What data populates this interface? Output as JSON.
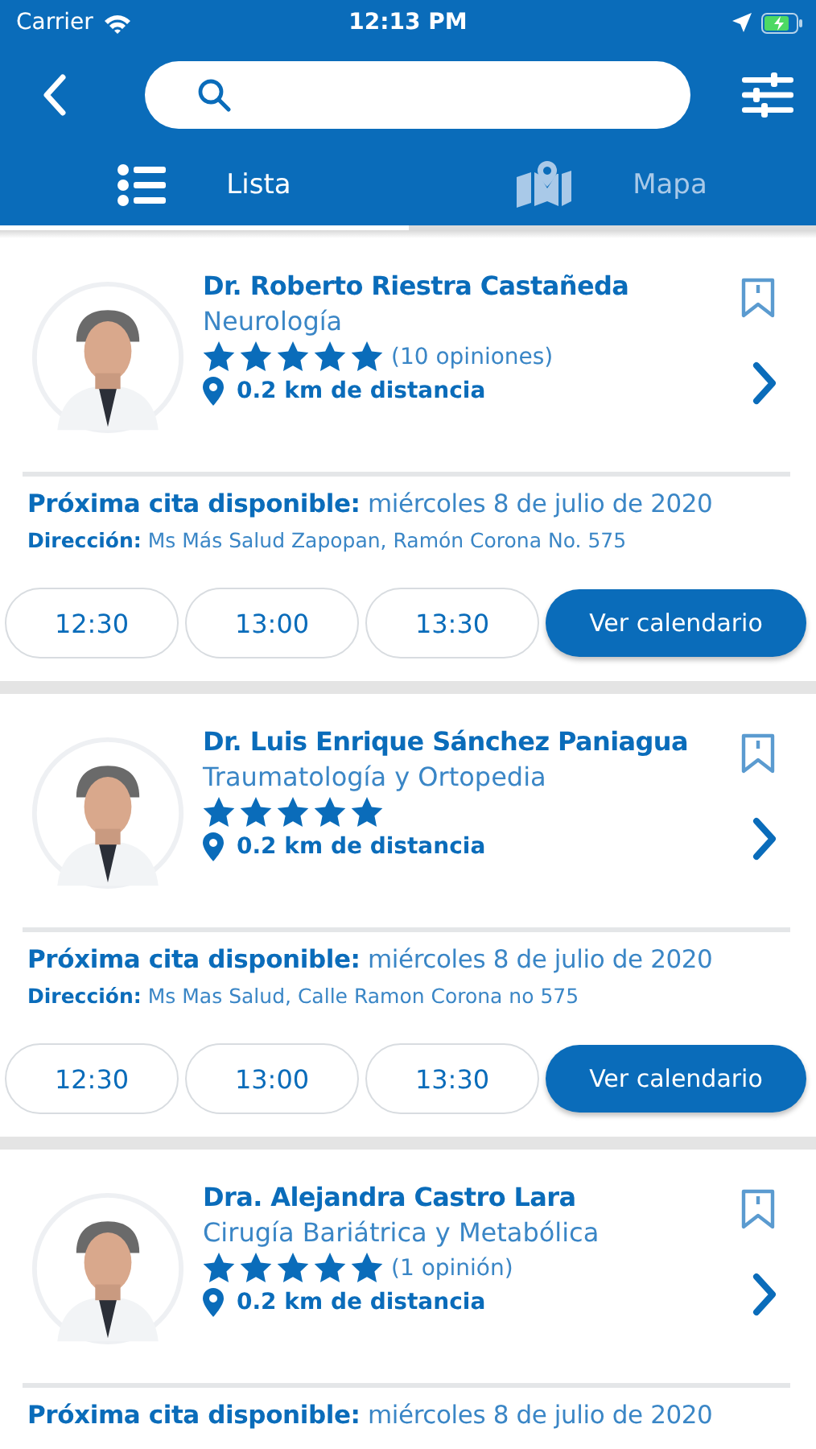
{
  "status_bar": {
    "carrier": "Carrier",
    "time": "12:13 PM"
  },
  "tabs": [
    {
      "label": "Lista",
      "kind": "list",
      "selected": true
    },
    {
      "label": "Mapa",
      "kind": "map",
      "selected": false
    }
  ],
  "doctors": [
    {
      "name": "Dr. Roberto Riestra Castañeda",
      "specialty": "Neurología",
      "stars": 5,
      "reviews": "(10 opiniones)",
      "distance": "0.2 km de distancia",
      "bookmarked": false,
      "next_label": "Próxima cita disponible:",
      "next_date": "miércoles 8 de julio de 2020",
      "address_label": "Dirección:",
      "address": "Ms Más Salud Zapopan, Ramón Corona No. 575",
      "slots": [
        "12:30",
        "13:00",
        "13:30"
      ],
      "calendar_button": "Ver calendario"
    },
    {
      "name": "Dr. Luis Enrique Sánchez Paniagua",
      "specialty": "Traumatología y Ortopedia",
      "stars": 5,
      "distance": "0.2 km de distancia",
      "bookmarked": false,
      "next_label": "Próxima cita disponible:",
      "next_date": "miércoles 8 de julio de 2020",
      "address_label": "Dirección:",
      "address": "Ms Mas Salud, Calle Ramon Corona no 575",
      "slots": [
        "12:30",
        "13:00",
        "13:30"
      ],
      "calendar_button": "Ver calendario"
    },
    {
      "name": "Dra. Alejandra Castro Lara",
      "specialty": "Cirugía Bariátrica y Metabólica",
      "stars": 5,
      "reviews": "(1 opinión)",
      "distance": "0.2 km de distancia",
      "bookmarked": false,
      "next_label": "Próxima cita disponible:",
      "next_date": "miércoles 8 de julio de 2020"
    }
  ]
}
